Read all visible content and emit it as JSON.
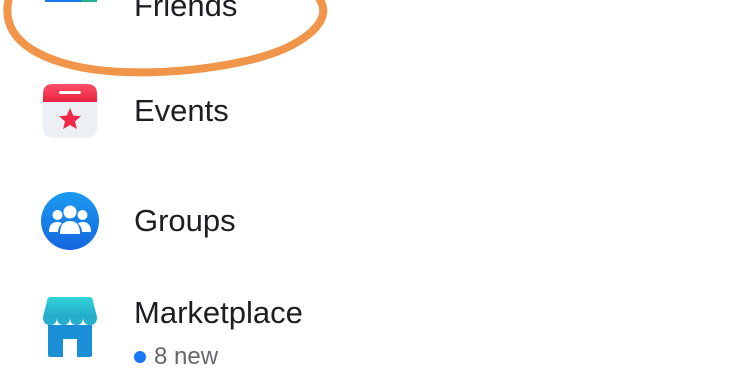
{
  "menu": {
    "items": [
      {
        "label": "Friends",
        "icon": "friends-icon"
      },
      {
        "label": "Events",
        "icon": "events-calendar-icon"
      },
      {
        "label": "Groups",
        "icon": "groups-icon"
      },
      {
        "label": "Marketplace",
        "icon": "marketplace-storefront-icon",
        "badge_text": "8 new"
      }
    ]
  },
  "annotation": {
    "shape": "hand-drawn-circle",
    "target": "Friends",
    "color": "#f0954a"
  },
  "colors": {
    "accent_blue": "#1877f2",
    "events_red": "#f02849",
    "marketplace_teal": "#29b7c9",
    "text_primary": "#1c1e21",
    "text_secondary": "#65676b"
  }
}
